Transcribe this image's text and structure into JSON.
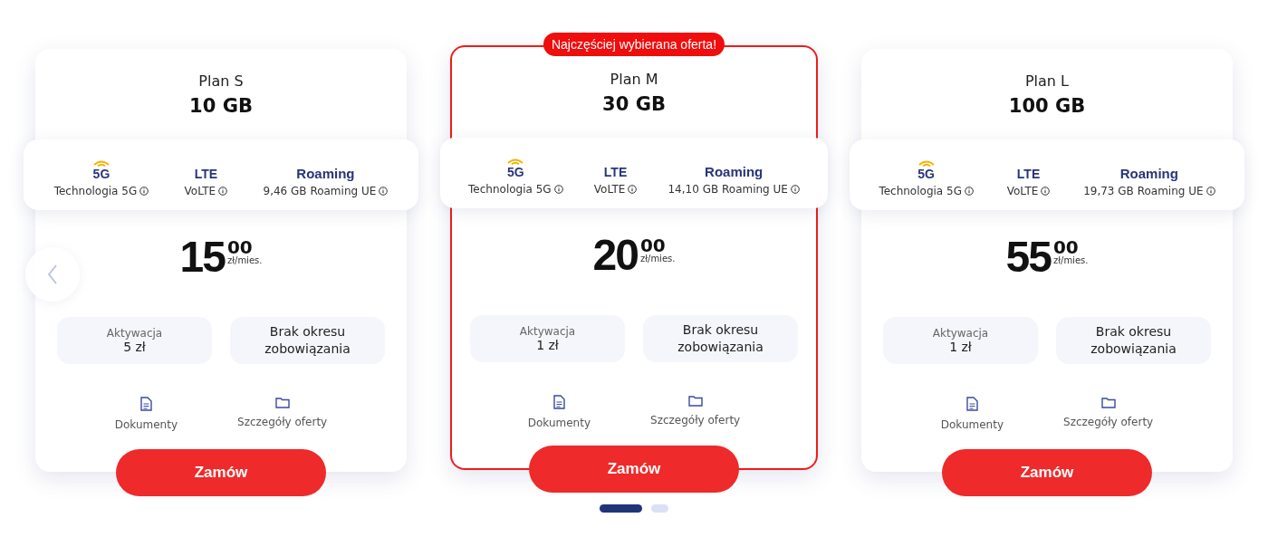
{
  "plans": [
    {
      "name": "Plan S",
      "data": "10 GB",
      "featured": false,
      "features": [
        {
          "kind": "network",
          "title": "5G",
          "label": "Technologia 5G"
        },
        {
          "kind": "lte",
          "title": "LTE",
          "label": "VoLTE"
        },
        {
          "kind": "roaming",
          "title": "Roaming",
          "label": "9,46 GB Roaming UE"
        }
      ],
      "price": "15",
      "cents": "00",
      "period": "zł/mies.",
      "activation_label": "Aktywacja",
      "activation_value": "5 zł",
      "commitment": "Brak okresu zobowiązania",
      "links": [
        {
          "kind": "document",
          "label": "Dokumenty"
        },
        {
          "kind": "folder",
          "label": "Szczegóły oferty"
        }
      ],
      "button": "Zamów"
    },
    {
      "name": "Plan M",
      "data": "30 GB",
      "featured": true,
      "badge": "Najczęściej wybierana oferta!",
      "features": [
        {
          "kind": "network",
          "title": "5G",
          "label": "Technologia 5G"
        },
        {
          "kind": "lte",
          "title": "LTE",
          "label": "VoLTE"
        },
        {
          "kind": "roaming",
          "title": "Roaming",
          "label": "14,10 GB Roaming UE"
        }
      ],
      "price": "20",
      "cents": "00",
      "period": "zł/mies.",
      "activation_label": "Aktywacja",
      "activation_value": "1 zł",
      "commitment": "Brak okresu zobowiązania",
      "links": [
        {
          "kind": "document",
          "label": "Dokumenty"
        },
        {
          "kind": "folder",
          "label": "Szczegóły oferty"
        }
      ],
      "button": "Zamów"
    },
    {
      "name": "Plan L",
      "data": "100 GB",
      "featured": false,
      "features": [
        {
          "kind": "network",
          "title": "5G",
          "label": "Technologia 5G"
        },
        {
          "kind": "lte",
          "title": "LTE",
          "label": "VoLTE"
        },
        {
          "kind": "roaming",
          "title": "Roaming",
          "label": "19,73 GB Roaming UE"
        }
      ],
      "price": "55",
      "cents": "00",
      "period": "zł/mies.",
      "activation_label": "Aktywacja",
      "activation_value": "1 zł",
      "commitment": "Brak okresu zobowiązania",
      "links": [
        {
          "kind": "document",
          "label": "Dokumenty"
        },
        {
          "kind": "folder",
          "label": "Szczegóły oferty"
        }
      ],
      "button": "Zamów"
    }
  ],
  "pager": [
    {
      "selected": true
    },
    {
      "selected": false
    }
  ]
}
